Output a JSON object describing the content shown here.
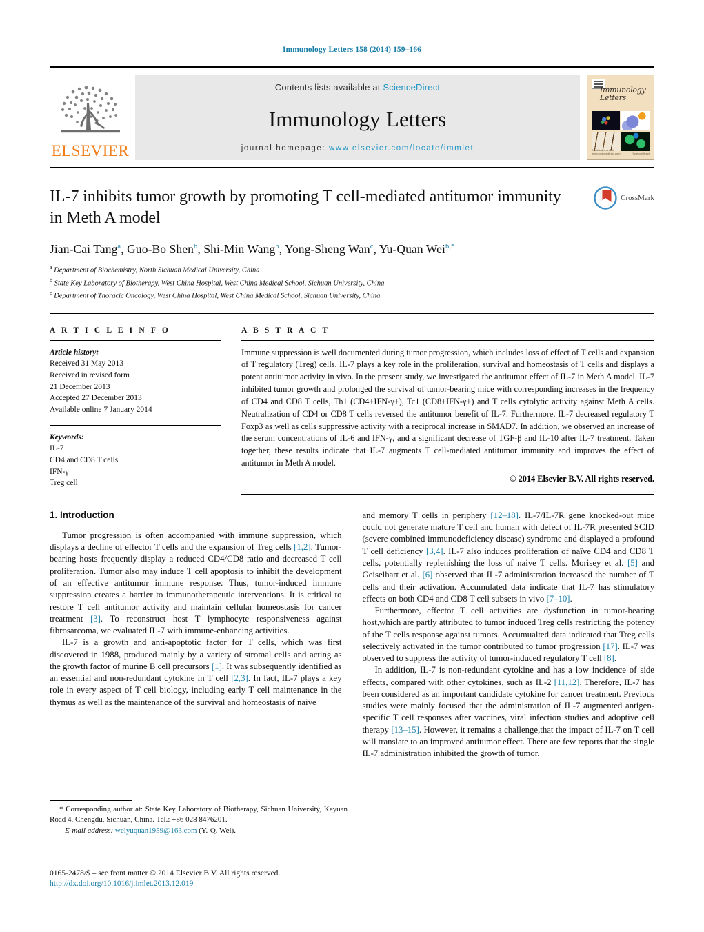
{
  "running_head": "Immunology Letters 158 (2014) 159–166",
  "masthead": {
    "publisher": "ELSEVIER",
    "contents_prefix": "Contents lists available at ",
    "contents_link": "ScienceDirect",
    "journal_title": "Immunology Letters",
    "homepage_prefix": "journal homepage:",
    "homepage_url": "www.elsevier.com/locate/immlet",
    "cover_script": "Immunology Letters",
    "cover_footer_left": "Available online at www.sciencedirect.com",
    "cover_footer_right": "ScienceDirect"
  },
  "article": {
    "title": "IL-7 inhibits tumor growth by promoting T cell-mediated antitumor immunity in Meth A model",
    "crossmark_label": "CrossMark",
    "authors_html": "Jian-Cai Tang<sup>a</sup>, Guo-Bo Shen<sup>b</sup>, Shi-Min Wang<sup>b</sup>, Yong-Sheng Wan<sup>c</sup>, Yu-Quan Wei<sup>b,</sup><sup>*</sup>",
    "affiliations": [
      "Department of Biochemistry, North Sichuan Medical University, China",
      "State Key Laboratory of Biotherapy, West China Hospital, West China Medical School, Sichuan University, China",
      "Department of Thoracic Oncology, West China Hospital, West China Medical School, Sichuan University, China"
    ],
    "affil_marks": [
      "a",
      "b",
      "c"
    ]
  },
  "article_info": {
    "heading": "A R T I C L E    I N F O",
    "history_label": "Article history:",
    "history_lines": [
      "Received 31 May 2013",
      "Received in revised form",
      "21 December 2013",
      "Accepted 27 December 2013",
      "Available online 7 January 2014"
    ],
    "keywords_label": "Keywords:",
    "keywords": [
      "IL-7",
      "CD4 and CD8 T cells",
      "IFN-γ",
      "Treg cell"
    ]
  },
  "abstract": {
    "heading": "A B S T R A C T",
    "text": "Immune suppression is well documented during tumor progression, which includes loss of effect of T cells and expansion of T regulatory (Treg) cells. IL-7 plays a key role in the proliferation, survival and homeostasis of T cells and displays a potent antitumor activity in vivo. In the present study, we investigated the antitumor effect of IL-7 in Meth A model. IL-7 inhibited tumor growth and prolonged the survival of tumor-bearing mice with corresponding increases in the frequency of CD4 and CD8 T cells, Th1 (CD4+IFN-γ+), Tc1 (CD8+IFN-γ+) and T cells cytolytic activity against Meth A cells. Neutralization of CD4 or CD8 T cells reversed the antitumor benefit of IL-7. Furthermore, IL-7 decreased regulatory T Foxp3 as well as cells suppressive activity with a reciprocal increase in SMAD7. In addition, we observed an increase of the serum concentrations of IL-6 and IFN-γ, and a significant decrease of TGF-β and IL-10 after IL-7 treatment. Taken together, these results indicate that IL-7 augments T cell-mediated antitumor immunity and improves the effect of antitumor in Meth A model.",
    "copyright": "© 2014 Elsevier B.V. All rights reserved."
  },
  "body": {
    "section_heading": "1.  Introduction",
    "left_paragraphs": [
      "Tumor progression is often accompanied with immune suppression, which displays a decline of effector T cells and the expansion of Treg cells [1,2]. Tumor-bearing hosts frequently display a reduced CD4/CD8 ratio and decreased T cell proliferation. Tumor also may induce T cell apoptosis to inhibit the development of an effective antitumor immune response. Thus, tumor-induced immune suppression creates a barrier to immunotherapeutic interventions. It is critical to restore T cell antitumor activity and maintain cellular homeostasis for cancer treatment [3]. To reconstruct host T lymphocyte responsiveness against fibrosarcoma, we evaluated IL-7 with immune-enhancing activities.",
      "IL-7 is a growth and anti-apoptotic factor for T cells, which was first discovered in 1988, produced mainly by a variety of stromal cells and acting as the growth factor of murine B cell precursors [1]. It was subsequently identified as an essential and non-redundant cytokine in T cell [2,3]. In fact, IL-7 plays a key role in every aspect of T cell biology, including early T cell maintenance in the thymus as well as the maintenance of the survival and homeostasis of naive"
    ],
    "right_paragraphs": [
      "and memory T cells in periphery [12–18]. IL-7/IL-7R gene knocked-out mice could not generate mature T cell and human with defect of IL-7R presented SCID (severe combined immunodeficiency disease) syndrome and displayed a profound T cell deficiency [3,4]. IL-7 also induces proliferation of naïve CD4 and CD8 T cells, potentially replenishing the loss of naive T cells. Morisey et al. [5] and Geiselhart et al. [6] observed that IL-7 administration increased the number of T cells and their activation. Accumulated data indicate that IL-7 has stimulatory effects on both CD4 and CD8 T cell subsets in vivo [7–10].",
      "Furthermore, effector T cell activities are dysfunction in tumor-bearing host,which are partly attributed to tumor induced Treg cells restricting the potency of the T cells response against tumors. Accumualted data indicated that Treg cells selectively activated in the tumor contributed to tumor progression [17]. IL-7 was observed to suppress the activity of tumor-induced regulatory T cell [8].",
      "In addition, IL-7 is non-redundant cytokine and has a low incidence of side effects, compared with other cytokines, such as IL-2 [11,12]. Therefore, IL-7 has been considered as an important candidate cytokine for cancer treatment. Previous studies were mainly focused that the administration of IL-7 augmented antigen-specific T cell responses after vaccines, viral infection studies and adoptive cell therapy [13–15]. However, it remains a challenge,that the impact of IL-7 on T cell will translate to an improved antitumor effect. There are few reports that the single IL-7 administration inhibited the growth of tumor."
    ]
  },
  "footnotes": {
    "corresponding_marker": "*",
    "corresponding_text": "Corresponding author at: State Key Laboratory of Biotherapy, Sichuan University, Keyuan Road 4, Chengdu, Sichuan, China. Tel.: +86 028 8476201.",
    "email_label": "E-mail address:",
    "email": "weiyuquan1959@163.com",
    "email_suffix": "(Y.-Q. Wei)."
  },
  "bottom": {
    "frontmatter": "0165-2478/$ – see front matter © 2014 Elsevier B.V. All rights reserved.",
    "doi": "http://dx.doi.org/10.1016/j.imlet.2013.12.019"
  },
  "colors": {
    "link": "#1a7fa8",
    "sciencedirect": "#2196c4",
    "elsevier_orange": "#F07F1A"
  }
}
